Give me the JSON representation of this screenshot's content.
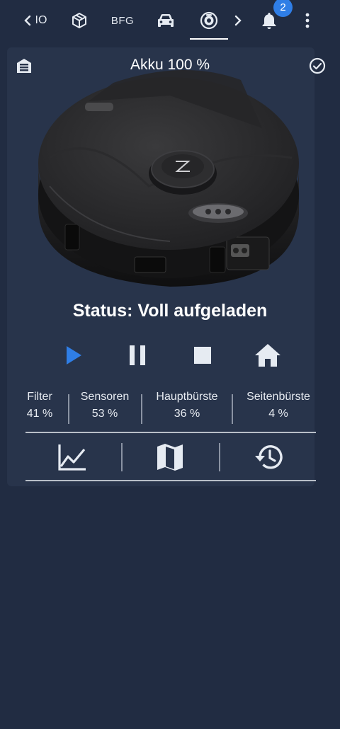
{
  "topbar": {
    "tabs": [
      {
        "label": "IO",
        "icon": "chevron-left-icon"
      },
      {
        "icon": "cube-icon"
      },
      {
        "label": "BFG"
      },
      {
        "icon": "car-icon"
      },
      {
        "icon": "robot-vacuum-icon",
        "active": true
      },
      {
        "icon": "chevron-right-icon"
      }
    ],
    "notifications": {
      "icon": "bell-icon",
      "count": "2"
    },
    "menu_icon": "more-vert-icon"
  },
  "card": {
    "battery": "Akku 100 %",
    "status": "Status: Voll aufgeladen",
    "controls": [
      "play-icon",
      "pause-icon",
      "stop-icon",
      "home-icon"
    ],
    "consumables": [
      {
        "label": "Filter",
        "value": "41 %"
      },
      {
        "label": "Sensoren",
        "value": "53 %"
      },
      {
        "label": "Hauptbürste",
        "value": "36 %"
      },
      {
        "label": "Seitenbürste",
        "value": "4 %"
      }
    ],
    "bottom_actions": [
      "chart-icon",
      "map-icon",
      "history-icon"
    ]
  },
  "colors": {
    "background": "#212c42",
    "card": "#28344b",
    "accent": "#2f7ee6",
    "text": "#ffffff"
  }
}
